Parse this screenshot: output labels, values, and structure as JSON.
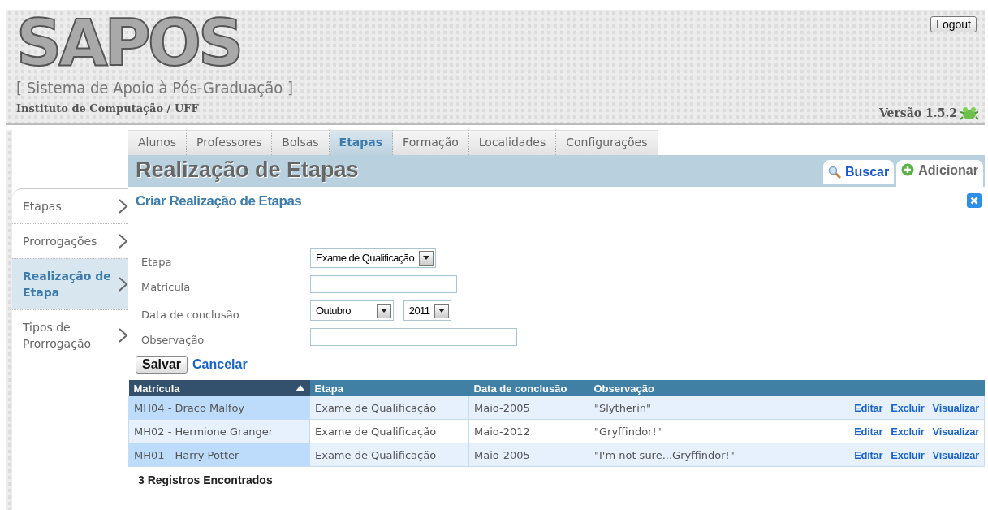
{
  "header": {
    "logo": "SAPOS",
    "subtitle": "[ Sistema de Apoio à Pós-Graduação ]",
    "institute": "Instituto de Computação / UFF",
    "logout": "Logout",
    "version": "Versão 1.5.2"
  },
  "main_tabs": [
    {
      "label": "Alunos",
      "selected": false
    },
    {
      "label": "Professores",
      "selected": false
    },
    {
      "label": "Bolsas",
      "selected": false
    },
    {
      "label": "Etapas",
      "selected": true
    },
    {
      "label": "Formação",
      "selected": false
    },
    {
      "label": "Localidades",
      "selected": false
    },
    {
      "label": "Configurações",
      "selected": false
    }
  ],
  "sidebar": {
    "items": [
      {
        "label": "Etapas",
        "selected": false
      },
      {
        "label": "Prorrogações",
        "selected": false
      },
      {
        "label": "Realização de Etapa",
        "selected": true
      },
      {
        "label": "Tipos de Prorrogação",
        "selected": false
      }
    ]
  },
  "page_title": "Realização de Etapas",
  "action_tabs": [
    {
      "label": "Buscar",
      "kind": "search",
      "selected": false
    },
    {
      "label": "Adicionar",
      "kind": "add",
      "selected": true
    }
  ],
  "form": {
    "title": "Criar Realização de Etapas",
    "fields": [
      {
        "label": "Etapa",
        "controls": [
          {
            "kind": "select",
            "value": "Exame de Qualificação"
          }
        ]
      },
      {
        "label": "Matrícula",
        "controls": [
          {
            "kind": "text"
          }
        ]
      },
      {
        "label": "Data de conclusão",
        "controls": [
          {
            "kind": "select",
            "value": "Outubro"
          },
          {
            "kind": "select",
            "value": "2011"
          }
        ]
      },
      {
        "label": "Observação",
        "controls": [
          {
            "kind": "text",
            "wide": true
          }
        ]
      }
    ],
    "save": "Salvar",
    "cancel": "Cancelar"
  },
  "table": {
    "columns": [
      {
        "label": "Matrícula",
        "sorted": true
      },
      {
        "label": "Etapa",
        "sorted": false
      },
      {
        "label": "Data de conclusão",
        "sorted": false
      },
      {
        "label": "Observação",
        "sorted": false
      }
    ],
    "rows": [
      {
        "cells": [
          "MH04 - Draco Malfoy",
          "Exame de Qualificação",
          "Maio-2005",
          "\"Slytherin\""
        ],
        "actions": [
          "Editar",
          "Excluir",
          "Visualizar"
        ]
      },
      {
        "cells": [
          "MH02 - Hermione Granger",
          "Exame de Qualificação",
          "Maio-2012",
          "\"Gryffindor!\""
        ],
        "actions": [
          "Editar",
          "Excluir",
          "Visualizar"
        ]
      },
      {
        "cells": [
          "MH01 - Harry Potter",
          "Exame de Qualificação",
          "Maio-2005",
          "\"I'm not sure...Gryffindor!\""
        ],
        "actions": [
          "Editar",
          "Excluir",
          "Visualizar"
        ]
      }
    ],
    "footer": "3 Registros Encontrados"
  }
}
